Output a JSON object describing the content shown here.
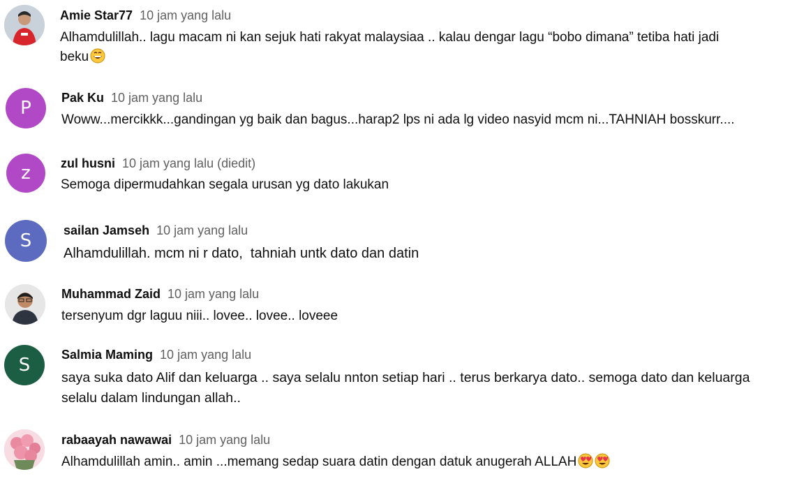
{
  "comments": [
    {
      "author": "Amie Star77",
      "time": "10 jam yang lalu",
      "text_line1": "Alhamdulillah.. lagu macam ni kan sejuk hati rakyat malaysiaa .. kalau dengar lagu “bobo dimana” tetiba hati jadi",
      "text_line2": "beku",
      "avatar": {
        "type": "photo",
        "icon": "person-fila-shirt",
        "color": "#d7dde5"
      }
    },
    {
      "author": "Pak Ku",
      "time": "10 jam yang lalu",
      "text": "Woww...mercikkk...gandingan yg baik dan bagus...harap2 lps ni ada lg video nasyid mcm ni...TAHNIAH bosskurr....",
      "avatar": {
        "letter": "P",
        "color": "#b149c7"
      }
    },
    {
      "author": "zul husni",
      "time": "10 jam yang lalu (diedit)",
      "text": "Semoga dipermudahkan segala urusan yg dato lakukan",
      "avatar": {
        "letter": "z",
        "color": "#b149c7"
      }
    },
    {
      "author": "sailan Jamseh",
      "time": "10 jam yang lalu",
      "text": "Alhamdulillah. mcm ni r dato,  tahniah untk dato dan datin",
      "avatar": {
        "letter": "S",
        "color": "#5c6bc0"
      }
    },
    {
      "author": "Muhammad Zaid",
      "time": "10 jam yang lalu",
      "text": "tersenyum dgr laguu niii.. lovee.. lovee.. loveee",
      "avatar": {
        "type": "photo",
        "icon": "person-glasses",
        "color": "#dcdcdc"
      }
    },
    {
      "author": "Salmia Maming",
      "time": "10 jam yang lalu",
      "text_line1": "saya suka dato Alif dan keluarga .. saya selalu nnton setiap hari .. terus berkarya dato.. semoga dato dan keluarga",
      "text_line2": "selalu dalam lindungan allah..",
      "avatar": {
        "letter": "S",
        "color": "#1b5e43"
      }
    },
    {
      "author": "rabaayah nawawai",
      "time": "10 jam yang lalu",
      "text": "Alhamdulillah amin.. amin ...memang sedap suara datin dengan datuk anugerah ALLAH",
      "avatar": {
        "type": "photo",
        "icon": "pink-roses",
        "color": "#f4c6d0"
      }
    }
  ]
}
